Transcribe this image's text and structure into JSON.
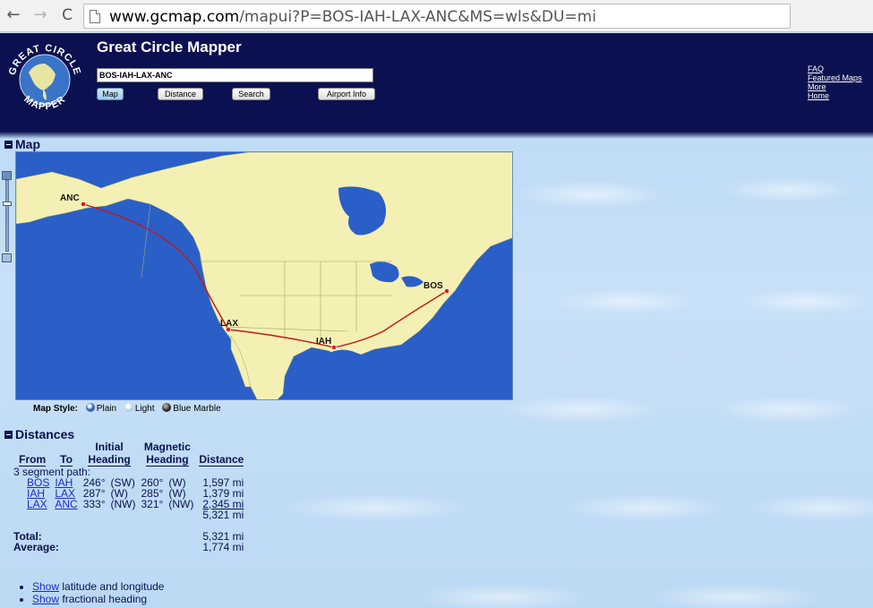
{
  "browser": {
    "url_domain": "www.gcmap.com",
    "url_path": "/mapui?P=BOS-IAH-LAX-ANC&MS=wls&DU=mi",
    "back_glyph": "←",
    "forward_glyph": "→",
    "reload_glyph": "C"
  },
  "header": {
    "logo_text": "GREAT CIRCLE MAPPER",
    "title": "Great Circle Mapper",
    "route_value": "BOS-IAH-LAX-ANC",
    "buttons": {
      "map": "Map",
      "distance": "Distance",
      "search": "Search",
      "airport_info": "Airport Info"
    },
    "links": [
      "FAQ",
      "Featured Maps",
      "More",
      "Home"
    ]
  },
  "map_section": {
    "heading": "Map",
    "airports": [
      "ANC",
      "BOS",
      "LAX",
      "IAH"
    ],
    "style_label": "Map Style:",
    "styles": [
      "Plain",
      "Light",
      "Blue Marble"
    ],
    "colors": {
      "ocean": "#2a5fc8",
      "land": "#f4f0b4",
      "route": "#c41818"
    }
  },
  "distances_section": {
    "heading": "Distances",
    "col_headers": {
      "from": "From",
      "to": "To",
      "initial_1": "Initial",
      "initial_2": "Heading",
      "magnetic_1": "Magnetic",
      "magnetic_2": "Heading",
      "distance": "Distance"
    },
    "path_note": "3 segment path:",
    "rows": [
      {
        "from": "BOS",
        "to": "IAH",
        "initial": "246°",
        "initial_dir": "(SW)",
        "magnetic": "260°",
        "magnetic_dir": "(W)",
        "distance": "1,597 mi"
      },
      {
        "from": "IAH",
        "to": "LAX",
        "initial": "287°",
        "initial_dir": "(W)",
        "magnetic": "285°",
        "magnetic_dir": "(W)",
        "distance": "1,379 mi"
      },
      {
        "from": "LAX",
        "to": "ANC",
        "initial": "333°",
        "initial_dir": "(NW)",
        "magnetic": "321°",
        "magnetic_dir": "(NW)",
        "distance": "2,345 mi"
      }
    ],
    "subtotal": "5,321 mi",
    "total_label": "Total:",
    "total_value": "5,321 mi",
    "average_label": "Average:",
    "average_value": "1,774 mi"
  },
  "options": [
    {
      "link": "Show",
      "text": " latitude and longitude"
    },
    {
      "link": "Show",
      "text": " fractional heading"
    }
  ]
}
